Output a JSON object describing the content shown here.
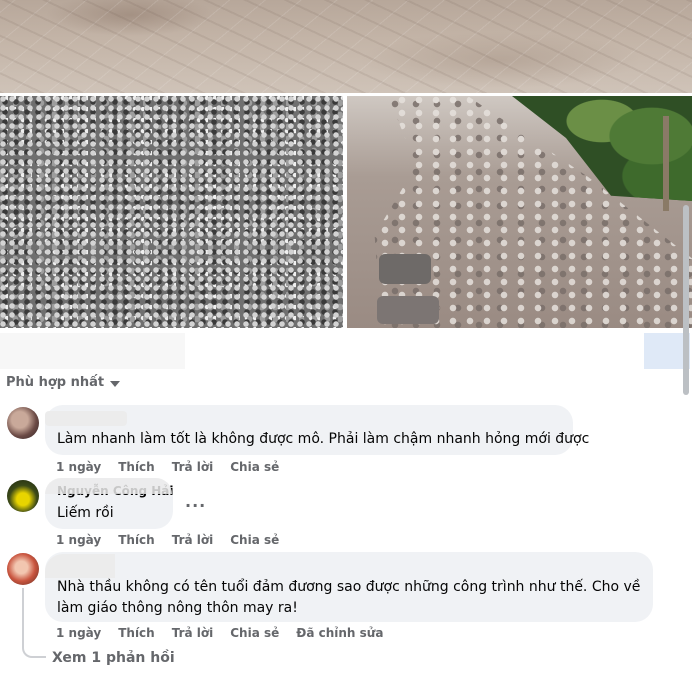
{
  "sort": {
    "label": "Phù hợp nhất"
  },
  "comments": [
    {
      "author": "",
      "text": "Làm nhanh làm tốt là không được mô. Phải làm chậm nhanh hỏng mới được",
      "actions": {
        "time": "1 ngày",
        "like": "Thích",
        "reply": "Trả lời",
        "share": "Chia sẻ"
      }
    },
    {
      "author": "Nguyễn Công Hải",
      "text": "Liếm rồi",
      "more": "...",
      "actions": {
        "time": "1 ngày",
        "like": "Thích",
        "reply": "Trả lời",
        "share": "Chia sẻ"
      }
    },
    {
      "author": "",
      "text_lines": [
        "Nhà thầu không có tên tuổi đảm đương sao được những công trình như thế. Cho về",
        "làm giáo thông nông thôn may ra!"
      ],
      "actions": {
        "time": "1 ngày",
        "like": "Thích",
        "reply": "Trả lời",
        "share": "Chia sẻ",
        "edited": "Đã chỉnh sửa"
      }
    }
  ],
  "view_replies": "Xem 1 phản hồi",
  "colors": {
    "bubble": "#f0f2f5",
    "secondary_text": "#65676b",
    "primary_text": "#050505"
  }
}
